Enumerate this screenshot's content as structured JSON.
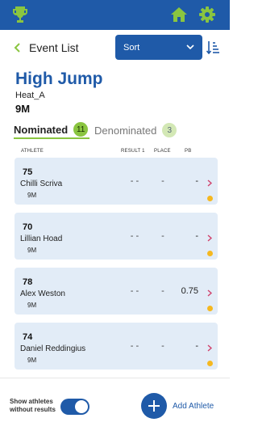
{
  "colors": {
    "brand": "#1f5aa8",
    "accent": "#8ac540",
    "status_dot": "#f5b820",
    "card": "#e2ecf7"
  },
  "topbar": {
    "logo_icon": "trophy-icon",
    "home_icon": "home-icon",
    "settings_icon": "gear-icon"
  },
  "nav": {
    "back_label": "Event List",
    "sort_label": "Sort",
    "sort_order_icon": "sort-ascending-icon"
  },
  "event": {
    "title": "High Jump",
    "heat": "Heat_A",
    "group": "9M"
  },
  "tabs": {
    "nominated": {
      "label": "Nominated",
      "count": "11"
    },
    "denominated": {
      "label": "Denominated",
      "count": "3"
    }
  },
  "columns": {
    "athlete": "ATHLETE",
    "result1": "RESULT 1",
    "place": "PLACE",
    "pb": "PB"
  },
  "athletes": [
    {
      "bib": "75",
      "name": "Chilli Scriva",
      "group": "9M",
      "result1": "- -",
      "place": "-",
      "pb": "-"
    },
    {
      "bib": "70",
      "name": "Lillian Hoad",
      "group": "9M",
      "result1": "- -",
      "place": "-",
      "pb": "-"
    },
    {
      "bib": "78",
      "name": "Alex Weston",
      "group": "9M",
      "result1": "- -",
      "place": "-",
      "pb": "0.75"
    },
    {
      "bib": "74",
      "name": "Daniel Reddingius",
      "group": "9M",
      "result1": "- -",
      "place": "-",
      "pb": "-"
    }
  ],
  "footer": {
    "toggle_label": "Show athletes without results",
    "toggle_on": true,
    "add_label": "Add Athlete"
  }
}
